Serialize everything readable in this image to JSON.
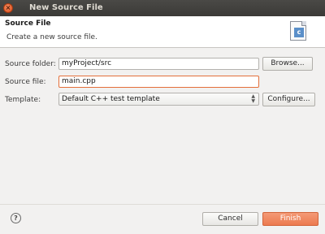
{
  "window": {
    "title": "New Source File"
  },
  "banner": {
    "title": "Source File",
    "description": "Create a new source file.",
    "icon_letter": "c",
    "icon": "c-source-file-icon"
  },
  "form": {
    "source_folder": {
      "label": "Source folder:",
      "value": "myProject/src"
    },
    "source_file": {
      "label": "Source file:",
      "value": "main.cpp"
    },
    "template": {
      "label": "Template:",
      "value": "Default C++ test template"
    }
  },
  "buttons": {
    "browse": "Browse...",
    "configure": "Configure...",
    "cancel": "Cancel",
    "finish": "Finish"
  },
  "help": {
    "glyph": "?"
  },
  "colors": {
    "accent": "#ec7a4f",
    "titlebar": "#3c3b37",
    "focus_border": "#e4703b"
  }
}
